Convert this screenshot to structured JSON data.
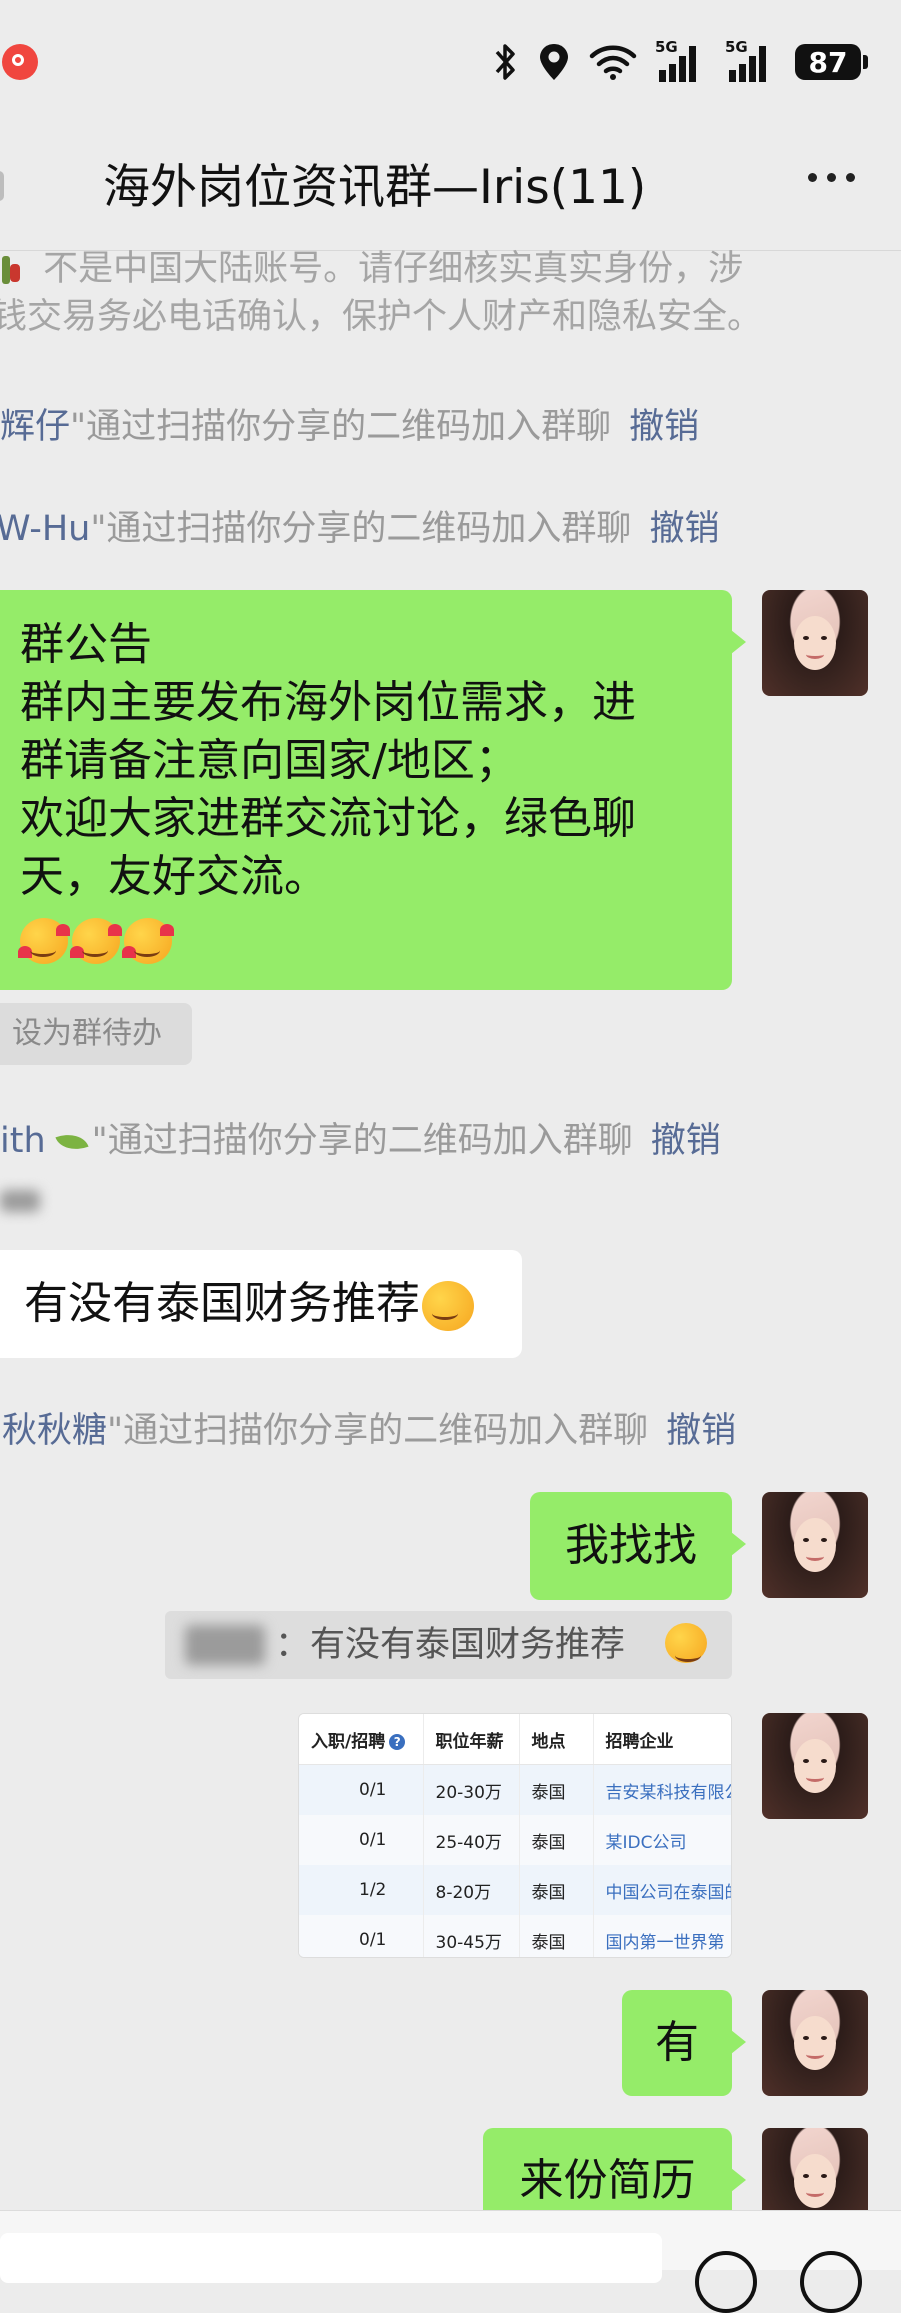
{
  "status_bar": {
    "signal1": "5G",
    "signal2": "5G",
    "battery": "87",
    "icons": [
      "bluetooth-icon",
      "location-icon",
      "wifi-icon",
      "signal-icon",
      "signal-icon",
      "battery-icon"
    ]
  },
  "header": {
    "title": "海外岗位资讯群—Iris(11)"
  },
  "warning": {
    "line1": "不是中国大陆账号。请仔细核实真实身份，涉",
    "line2": "钱交易务必电话确认，保护个人财产和隐私安全。"
  },
  "system_messages": [
    {
      "name": "辉仔",
      "text": "\"通过扫描你分享的二维码加入群聊",
      "action": "撤销"
    },
    {
      "name": "W-Hu",
      "text": "\"通过扫描你分享的二维码加入群聊",
      "action": "撤销"
    },
    {
      "name": "ith",
      "text": "\"通过扫描你分享的二维码加入群聊",
      "action": "撤销"
    },
    {
      "name": "秋秋糖",
      "text": "\"通过扫描你分享的二维码加入群聊",
      "action": "撤销"
    }
  ],
  "announcement": {
    "lines": [
      "群公告",
      "群内主要发布海外岗位需求，进",
      "群请备注意向国家/地区；",
      "欢迎大家进群交流讨论，绿色聊",
      "天，友好交流。"
    ]
  },
  "todo_chip": "设为群待办",
  "messages": {
    "incoming_question": "有没有泰国财务推荐",
    "reply1": "我找找",
    "quote": "：有没有泰国财务推荐",
    "reply2": "有",
    "reply3": "来份简历"
  },
  "table": {
    "headers": [
      "入职/招聘",
      "职位年薪",
      "地点",
      "招聘企业"
    ],
    "rows": [
      [
        "0/1",
        "20-30万",
        "泰国",
        "吉安某科技有限公"
      ],
      [
        "0/1",
        "25-40万",
        "泰国",
        "某IDC公司"
      ],
      [
        "1/2",
        "8-20万",
        "泰国",
        "中国公司在泰国的"
      ],
      [
        "0/1",
        "30-45万",
        "泰国",
        "国内第一世界第"
      ]
    ]
  },
  "colors": {
    "background": "#ececec",
    "green_bubble": "#95ec69",
    "link_blue": "#576b95"
  }
}
